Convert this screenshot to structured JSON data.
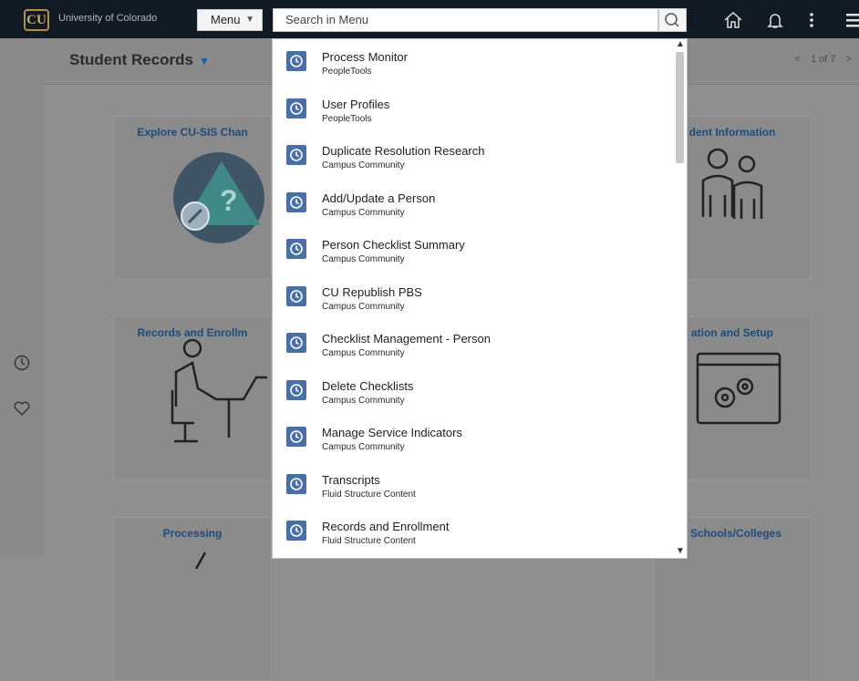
{
  "header": {
    "logo_glyph": "CU",
    "brand": "University of Colorado",
    "menu_label": "Menu",
    "search_placeholder": "Search in Menu",
    "icons": [
      "search-icon",
      "home-icon",
      "bell-icon",
      "kebab-icon",
      "hamburger-icon"
    ]
  },
  "rail": {
    "icons": [
      "recent-clock-icon",
      "favorites-heart-icon"
    ]
  },
  "page": {
    "title": "Student Records",
    "pager": {
      "prev": "<",
      "text": "1 of 7",
      "next": ">"
    }
  },
  "tiles": [
    {
      "title": "Explore CU-SIS Chan"
    },
    {
      "title": "dent Information"
    },
    {
      "title": "Records and Enrollm"
    },
    {
      "title": "ation and Setup"
    },
    {
      "title": "Processing"
    },
    {
      "title": "r Schools/Colleges"
    }
  ],
  "menu_results": [
    {
      "title": "Process Monitor",
      "subtitle": "PeopleTools"
    },
    {
      "title": "User Profiles",
      "subtitle": "PeopleTools"
    },
    {
      "title": "Duplicate Resolution Research",
      "subtitle": "Campus Community"
    },
    {
      "title": "Add/Update a Person",
      "subtitle": "Campus Community"
    },
    {
      "title": "Person Checklist Summary",
      "subtitle": "Campus Community"
    },
    {
      "title": "CU Republish PBS",
      "subtitle": "Campus Community"
    },
    {
      "title": "Checklist Management - Person",
      "subtitle": "Campus Community"
    },
    {
      "title": "Delete Checklists",
      "subtitle": "Campus Community"
    },
    {
      "title": "Manage Service Indicators",
      "subtitle": "Campus Community"
    },
    {
      "title": "Transcripts",
      "subtitle": "Fluid Structure Content"
    },
    {
      "title": "Records and Enrollment",
      "subtitle": "Fluid Structure Content"
    }
  ],
  "colors": {
    "topbar": "#111a22",
    "accent": "#4a6fa5",
    "tile_title": "#1c4b7e"
  }
}
